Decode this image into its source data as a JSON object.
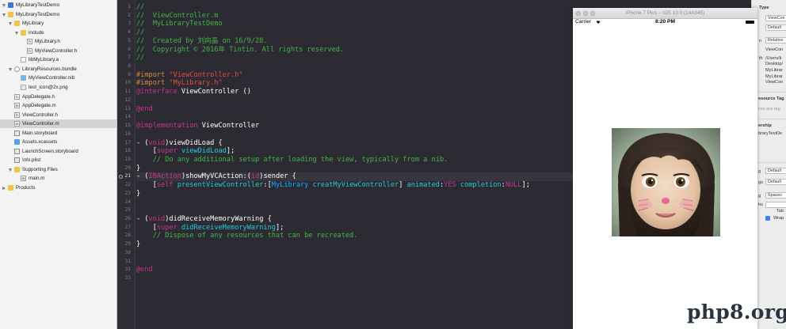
{
  "navigator": {
    "items": [
      {
        "label": "MyLibraryTestDemo",
        "icon": "project-icon",
        "kind": "project",
        "depth": 0,
        "expander": "open",
        "selected": false
      },
      {
        "label": "MyLibraryTestDemo",
        "icon": "folder-icon",
        "kind": "folder",
        "depth": 0,
        "expander": "open",
        "selected": false
      },
      {
        "label": "MyLibrary",
        "icon": "folder-icon",
        "kind": "folder",
        "depth": 1,
        "expander": "open",
        "selected": false
      },
      {
        "label": "include",
        "icon": "folder-icon",
        "kind": "folder",
        "depth": 2,
        "expander": "open",
        "selected": false
      },
      {
        "label": "MyLibrary.h",
        "icon": "header-file-icon",
        "kind": "file",
        "badge": "h",
        "depth": 3,
        "expander": "",
        "selected": false
      },
      {
        "label": "MyViewController.h",
        "icon": "header-file-icon",
        "kind": "file",
        "badge": "h",
        "depth": 3,
        "expander": "",
        "selected": false
      },
      {
        "label": "libMyLibrary.a",
        "icon": "library-file-icon",
        "kind": "lib",
        "depth": 2,
        "expander": "",
        "selected": false
      },
      {
        "label": "LibraryResources.bundle",
        "icon": "bundle-icon",
        "kind": "bundle",
        "depth": 1,
        "expander": "open",
        "selected": false
      },
      {
        "label": "MyViewController.nib",
        "icon": "nib-file-icon",
        "kind": "nib",
        "depth": 2,
        "expander": "",
        "selected": false
      },
      {
        "label": "test_icon@2x.png",
        "icon": "image-file-icon",
        "kind": "png",
        "depth": 2,
        "expander": "",
        "selected": false
      },
      {
        "label": "AppDelegate.h",
        "icon": "header-file-icon",
        "kind": "file",
        "badge": "h",
        "depth": 1,
        "expander": "",
        "selected": false
      },
      {
        "label": "AppDelegate.m",
        "icon": "implementation-file-icon",
        "kind": "file",
        "badge": "m",
        "depth": 1,
        "expander": "",
        "selected": false
      },
      {
        "label": "ViewController.h",
        "icon": "header-file-icon",
        "kind": "file",
        "badge": "h",
        "depth": 1,
        "expander": "",
        "selected": false
      },
      {
        "label": "ViewController.m",
        "icon": "implementation-file-icon",
        "kind": "file",
        "badge": "m",
        "depth": 1,
        "expander": "",
        "selected": true
      },
      {
        "label": "Main.storyboard",
        "icon": "storyboard-icon",
        "kind": "story",
        "depth": 1,
        "expander": "",
        "selected": false
      },
      {
        "label": "Assets.xcassets",
        "icon": "assets-icon",
        "kind": "assets",
        "depth": 1,
        "expander": "",
        "selected": false
      },
      {
        "label": "LaunchScreen.storyboard",
        "icon": "storyboard-icon",
        "kind": "story",
        "depth": 1,
        "expander": "",
        "selected": false
      },
      {
        "label": "Info.plist",
        "icon": "plist-file-icon",
        "kind": "story",
        "depth": 1,
        "expander": "",
        "selected": false
      },
      {
        "label": "Supporting Files",
        "icon": "folder-icon",
        "kind": "folder",
        "depth": 1,
        "expander": "open",
        "selected": false
      },
      {
        "label": "main.m",
        "icon": "implementation-file-icon",
        "kind": "file",
        "badge": "m",
        "depth": 2,
        "expander": "",
        "selected": false
      },
      {
        "label": "Products",
        "icon": "folder-icon",
        "kind": "folder",
        "depth": 0,
        "expander": "closed",
        "selected": false
      }
    ]
  },
  "editor": {
    "current_line": 21,
    "breakpoint_line": 21,
    "lines": [
      {
        "n": 1,
        "tokens": [
          [
            "comment",
            "//"
          ]
        ]
      },
      {
        "n": 2,
        "tokens": [
          [
            "comment",
            "//  ViewController.m"
          ]
        ]
      },
      {
        "n": 3,
        "tokens": [
          [
            "comment",
            "//  MyLibraryTestDemo"
          ]
        ]
      },
      {
        "n": 4,
        "tokens": [
          [
            "comment",
            "//"
          ]
        ]
      },
      {
        "n": 5,
        "tokens": [
          [
            "comment",
            "//  Created by 刘向晶 on 16/9/28."
          ]
        ]
      },
      {
        "n": 6,
        "tokens": [
          [
            "comment",
            "//  Copyright © 2016年 Tintin. All rights reserved."
          ]
        ]
      },
      {
        "n": 7,
        "tokens": [
          [
            "comment",
            "//"
          ]
        ]
      },
      {
        "n": 8,
        "tokens": []
      },
      {
        "n": 9,
        "tokens": [
          [
            "pre",
            "#import "
          ],
          [
            "str",
            "\"ViewController.h\""
          ]
        ]
      },
      {
        "n": 10,
        "tokens": [
          [
            "pre",
            "#import "
          ],
          [
            "str",
            "\"MyLibrary.h\""
          ]
        ]
      },
      {
        "n": 11,
        "tokens": [
          [
            "kw",
            "@interface"
          ],
          [
            "plain",
            " ViewController ()"
          ]
        ]
      },
      {
        "n": 12,
        "tokens": []
      },
      {
        "n": 13,
        "tokens": [
          [
            "kw",
            "@end"
          ]
        ]
      },
      {
        "n": 14,
        "tokens": []
      },
      {
        "n": 15,
        "tokens": [
          [
            "kw",
            "@implementation"
          ],
          [
            "plain",
            " ViewController"
          ]
        ]
      },
      {
        "n": 16,
        "tokens": []
      },
      {
        "n": 17,
        "tokens": [
          [
            "plain",
            "- ("
          ],
          [
            "kw",
            "void"
          ],
          [
            "plain",
            ")viewDidLoad {"
          ]
        ]
      },
      {
        "n": 18,
        "tokens": [
          [
            "plain",
            "    ["
          ],
          [
            "kw",
            "super"
          ],
          [
            "plain",
            " "
          ],
          [
            "meth",
            "viewDidLoad"
          ],
          [
            "plain",
            "];"
          ]
        ]
      },
      {
        "n": 19,
        "tokens": [
          [
            "comment",
            "    // Do any additional setup after loading the view, typically from a nib."
          ]
        ]
      },
      {
        "n": 20,
        "tokens": [
          [
            "plain",
            "}"
          ]
        ]
      },
      {
        "n": 21,
        "tokens": [
          [
            "plain",
            "- ("
          ],
          [
            "kw",
            "IBAction"
          ],
          [
            "plain",
            ")showMyVCAction:("
          ],
          [
            "kw",
            "id"
          ],
          [
            "plain",
            ")sender {"
          ]
        ]
      },
      {
        "n": 22,
        "tokens": [
          [
            "plain",
            "    ["
          ],
          [
            "kw",
            "self"
          ],
          [
            "plain",
            " "
          ],
          [
            "meth",
            "presentViewController"
          ],
          [
            "plain",
            ":["
          ],
          [
            "type",
            "MyLibrary"
          ],
          [
            "plain",
            " "
          ],
          [
            "meth",
            "creatMyViewController"
          ],
          [
            "plain",
            "] "
          ],
          [
            "meth",
            "animated"
          ],
          [
            "plain",
            ":"
          ],
          [
            "kw",
            "YES"
          ],
          [
            "plain",
            " "
          ],
          [
            "meth",
            "completion"
          ],
          [
            "plain",
            ":"
          ],
          [
            "kw",
            "NULL"
          ],
          [
            "plain",
            "];"
          ]
        ]
      },
      {
        "n": 23,
        "tokens": [
          [
            "plain",
            "}"
          ]
        ]
      },
      {
        "n": 24,
        "tokens": []
      },
      {
        "n": 25,
        "tokens": []
      },
      {
        "n": 26,
        "tokens": [
          [
            "plain",
            "- ("
          ],
          [
            "kw",
            "void"
          ],
          [
            "plain",
            ")didReceiveMemoryWarning {"
          ]
        ]
      },
      {
        "n": 27,
        "tokens": [
          [
            "plain",
            "    ["
          ],
          [
            "kw",
            "super"
          ],
          [
            "plain",
            " "
          ],
          [
            "meth",
            "didReceiveMemoryWarning"
          ],
          [
            "plain",
            "];"
          ]
        ]
      },
      {
        "n": 28,
        "tokens": [
          [
            "comment",
            "    // Dispose of any resources that can be recreated."
          ]
        ]
      },
      {
        "n": 29,
        "tokens": [
          [
            "plain",
            "}"
          ]
        ]
      },
      {
        "n": 30,
        "tokens": []
      },
      {
        "n": 31,
        "tokens": []
      },
      {
        "n": 32,
        "tokens": [
          [
            "kw",
            "@end"
          ]
        ]
      },
      {
        "n": 33,
        "tokens": []
      }
    ]
  },
  "inspector": {
    "heading_type": "Type",
    "type_field": "ViewCon",
    "location_field": "Default",
    "rel_label": "n",
    "relative_field": "Relative",
    "filename_value": "ViewCon",
    "path_label": "th",
    "path_lines": [
      "/Users/li",
      "Desktop/",
      "MyLibrar",
      "MyLibrar",
      "ViewCon"
    ],
    "resource_heading": "esource Tag",
    "resource_hint": "ces are tag",
    "ownership_heading": "ership",
    "ownership_value": "braryTestDe",
    "encoding_label": "g",
    "encoding_field": "Default",
    "endings_label": "gs",
    "endings_field": "Default",
    "indent_label": "g",
    "indent_field": "Spaces",
    "widths_label": "hs",
    "tab_label": "Tab",
    "wrap_label": "Wrap"
  },
  "simulator": {
    "title": "iPhone 7 Plus – iOS 10.0 (14A345)",
    "carrier": "Carrier",
    "time": "8:20 PM"
  },
  "watermark": "php8.org",
  "colors": {
    "editor_bg": "#2c2b33",
    "comment": "#41b645",
    "keyword": "#c8338f",
    "preprocessor": "#d48c3a",
    "string": "#e9493f",
    "method": "#23cbd9",
    "type": "#00b1ff"
  }
}
